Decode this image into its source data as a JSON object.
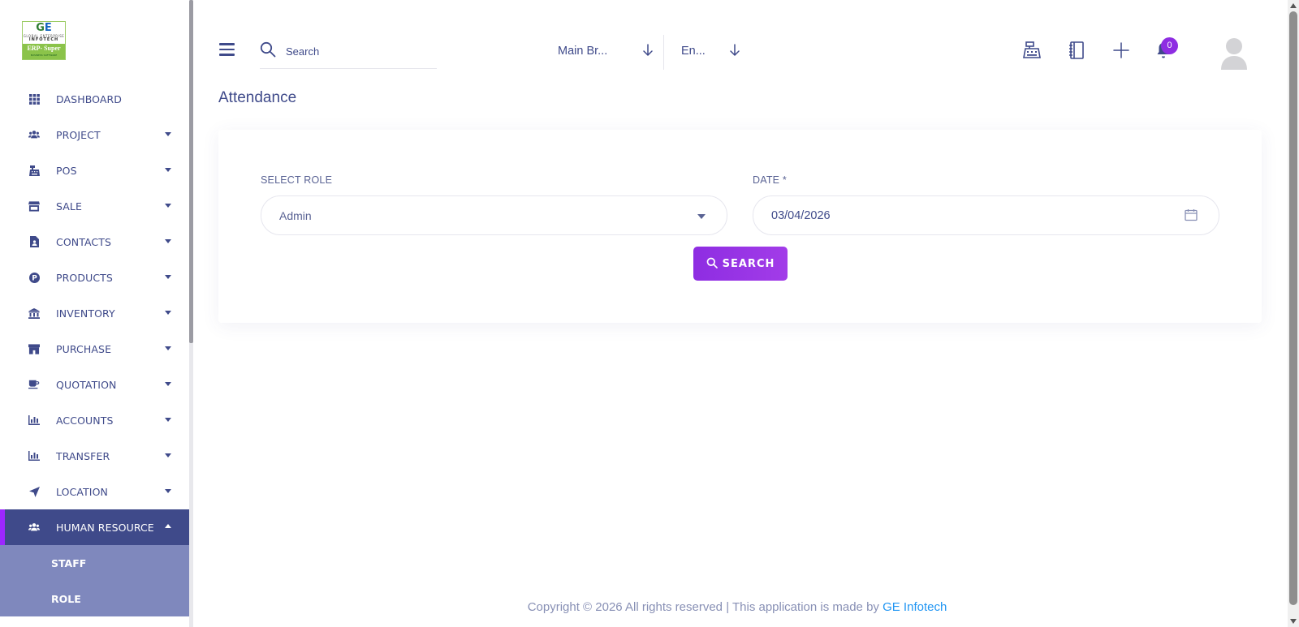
{
  "logo": {
    "top_text": "GE",
    "tagline": "GLOBAL ENTERPRISE",
    "company": "INFOTECH",
    "product": "ERP- Super",
    "subtitle": "BUSINESS SOFTWARE"
  },
  "sidebar": {
    "items": [
      {
        "label": "DASHBOARD",
        "icon": "grid-icon",
        "has_caret": false
      },
      {
        "label": "PROJECT",
        "icon": "users-icon",
        "has_caret": true
      },
      {
        "label": "POS",
        "icon": "cash-register-icon",
        "has_caret": true
      },
      {
        "label": "SALE",
        "icon": "store-icon",
        "has_caret": true
      },
      {
        "label": "CONTACTS",
        "icon": "contact-file-icon",
        "has_caret": true
      },
      {
        "label": "PRODUCTS",
        "icon": "product-badge-icon",
        "has_caret": true
      },
      {
        "label": "INVENTORY",
        "icon": "bank-icon",
        "has_caret": true
      },
      {
        "label": "PURCHASE",
        "icon": "shop-icon",
        "has_caret": true
      },
      {
        "label": "QUOTATION",
        "icon": "coffee-icon",
        "has_caret": true
      },
      {
        "label": "ACCOUNTS",
        "icon": "bar-chart-icon",
        "has_caret": true
      },
      {
        "label": "TRANSFER",
        "icon": "bar-chart-icon",
        "has_caret": true
      },
      {
        "label": "LOCATION",
        "icon": "location-arrow-icon",
        "has_caret": true
      },
      {
        "label": "HUMAN RESOURCE",
        "icon": "users-icon",
        "has_caret": true,
        "active": true
      }
    ],
    "subitems": [
      {
        "label": "STAFF"
      },
      {
        "label": "ROLE"
      }
    ]
  },
  "header": {
    "search_placeholder": "Search",
    "branch_value": "Main Br...",
    "language_value": "En...",
    "notification_count": "0"
  },
  "main": {
    "title": "Attendance",
    "role_label": "SELECT ROLE",
    "role_value": "Admin",
    "date_label": "DATE *",
    "date_value": "03/04/2026",
    "search_button": "SEARCH"
  },
  "footer": {
    "text": "Copyright © 2026 All rights reserved | This application is made by",
    "link": "GE Infotech"
  },
  "colors": {
    "primary": "#3f4a8a",
    "accent": "#8e2de2",
    "subnav": "#7f88bd",
    "link": "#2196f3"
  }
}
